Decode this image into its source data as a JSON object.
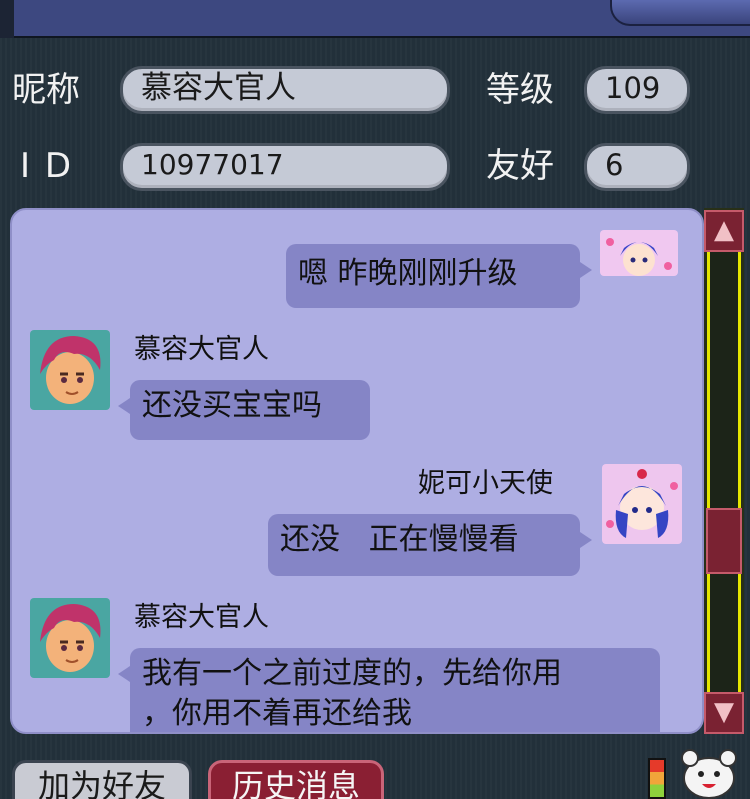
{
  "profile": {
    "nickname_label": "昵称",
    "nickname_value": "慕容大官人",
    "level_label": "等级",
    "level_value": "109",
    "id_label": "I D",
    "id_value": "10977017",
    "friendship_label": "友好",
    "friendship_value": "6"
  },
  "messages": [
    {
      "sender": "",
      "side": "right",
      "text": "嗯 昨晚刚刚升级"
    },
    {
      "sender": "慕容大官人",
      "side": "left",
      "text": "还没买宝宝吗"
    },
    {
      "sender": "妮可小天使",
      "side": "right",
      "text": "还没   正在慢慢看"
    },
    {
      "sender": "慕容大官人",
      "side": "left",
      "text": "我有一个之前过度的，先给你用\n，你用不着再还给我"
    }
  ],
  "bottom": {
    "add_friend_label": "加为好友",
    "history_label": "历史消息"
  },
  "colors": {
    "chat_bg": "#aeaee3",
    "bubble": "#8585c6",
    "field": "#c5cad6",
    "accent_red": "#8a1f33",
    "scroll_rail": "#e6e600"
  }
}
